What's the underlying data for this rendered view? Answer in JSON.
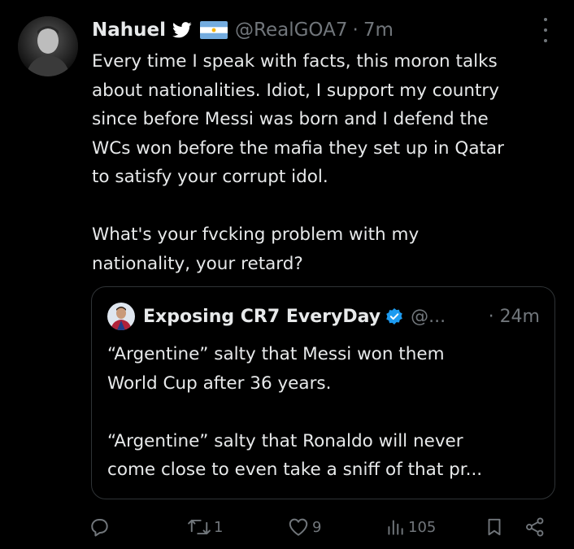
{
  "tweet": {
    "author_name": "Nahuel",
    "handle": "@RealGOA7",
    "separator": "·",
    "time": "7m",
    "text": "Every time I speak with facts, this moron talks\nabout nationalities. Idiot, I support my country\nsince before Messi was born and I defend the\nWCs won before the mafia they set up in Qatar\nto satisfy your corrupt idol.\n\nWhat's your fvcking problem with my\nnationality, your retard?"
  },
  "quoted_tweet": {
    "author_name": "Exposing CR7 EveryDay",
    "handle": "@...",
    "separator": "·",
    "time": "24m",
    "text": "“Argentine” salty that Messi won them\nWorld Cup after 36 years.\n\n“Argentine” salty that Ronaldo will never\ncome close to even take a sniff of that pr..."
  },
  "actions": {
    "reply_count": "",
    "retweet_count": "1",
    "like_count": "9",
    "views_count": "105"
  },
  "icons": {
    "bird": "twitter-bird-icon",
    "flag": "argentina-flag-icon",
    "verified": "verified-badge-icon",
    "more": "more-icon",
    "reply": "reply-icon",
    "retweet": "retweet-icon",
    "like": "heart-icon",
    "views": "views-icon",
    "bookmark": "bookmark-icon",
    "share": "share-icon"
  },
  "colors": {
    "background": "#000000",
    "text": "#e7e9ea",
    "secondary": "#71767b",
    "border": "#2f3336",
    "verified": "#1d9bf0",
    "twitter_bird": "#ffffff",
    "flag_blue": "#74acdf",
    "flag_sun": "#f6b40e"
  }
}
